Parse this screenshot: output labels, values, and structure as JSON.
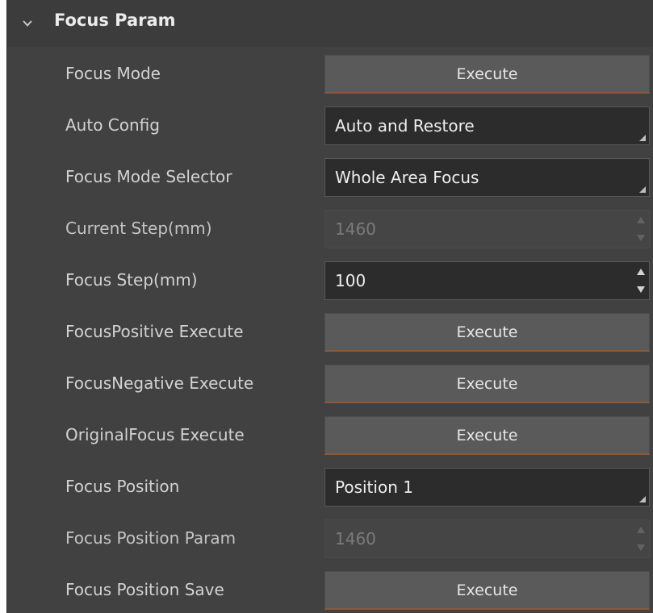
{
  "section": {
    "title": "Focus Param",
    "expanded_icon": "chevron-down-icon"
  },
  "rows": [
    {
      "label": "Focus Mode",
      "type": "button",
      "value": "Execute"
    },
    {
      "label": "Auto Config",
      "type": "combo",
      "value": "Auto and Restore"
    },
    {
      "label": "Focus Mode Selector",
      "type": "combo",
      "value": "Whole Area Focus"
    },
    {
      "label": "Current Step(mm)",
      "type": "spin-disabled",
      "value": "1460"
    },
    {
      "label": "Focus Step(mm)",
      "type": "spin",
      "value": "100"
    },
    {
      "label": "FocusPositive Execute",
      "type": "button",
      "value": "Execute"
    },
    {
      "label": "FocusNegative Execute",
      "type": "button",
      "value": "Execute"
    },
    {
      "label": "OriginalFocus Execute",
      "type": "button",
      "value": "Execute"
    },
    {
      "label": "Focus Position",
      "type": "combo",
      "value": "Position 1"
    },
    {
      "label": "Focus Position Param",
      "type": "spin-disabled",
      "value": "1460"
    },
    {
      "label": "Focus Position Save",
      "type": "button",
      "value": "Execute"
    }
  ],
  "colors": {
    "panel_bg": "#414141",
    "control_bg": "#2c2c2c",
    "button_bg": "#5a5a5a",
    "text": "#d2d2d2"
  }
}
